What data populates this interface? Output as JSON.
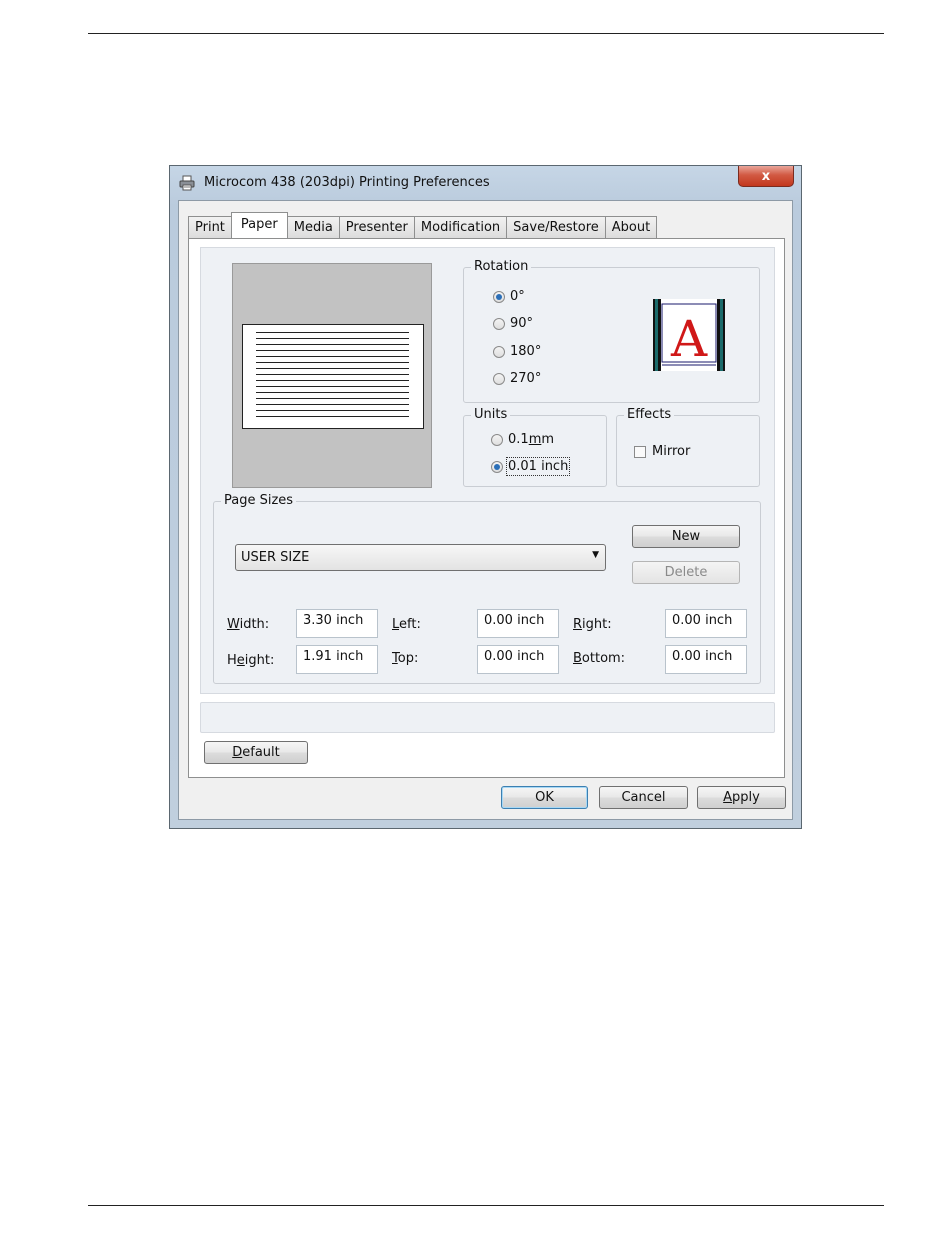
{
  "window": {
    "title": "Microcom 438 (203dpi) Printing Preferences",
    "close_glyph": "x",
    "icon": "printer-icon"
  },
  "tabs": [
    {
      "label": "Print"
    },
    {
      "label": "Paper"
    },
    {
      "label": "Media"
    },
    {
      "label": "Presenter"
    },
    {
      "label": "Modification"
    },
    {
      "label": "Save/Restore"
    },
    {
      "label": "About"
    }
  ],
  "active_tab": "Paper",
  "rotation": {
    "label": "Rotation",
    "options": [
      "0°",
      "90°",
      "180°",
      "270°"
    ],
    "selected": "0°",
    "preview_letter": "A"
  },
  "units": {
    "label": "Units",
    "options": [
      {
        "pre": "0.1 ",
        "accel": "m",
        "post": "m"
      },
      {
        "pre": "0.01 inch",
        "accel": "",
        "post": ""
      }
    ],
    "selected": "0.01 inch"
  },
  "effects": {
    "label": "Effects",
    "mirror_label": "Mirror",
    "mirror_checked": false
  },
  "page_sizes": {
    "label": "Page Sizes",
    "selected": "USER SIZE",
    "new_button": "New",
    "delete_button": "Delete",
    "fields": {
      "width": {
        "accel": "W",
        "rest": "idth:",
        "value": "3.30 inch"
      },
      "height": {
        "pre": "H",
        "accel": "e",
        "rest": "ight:",
        "value": "1.91 inch"
      },
      "left": {
        "accel": "L",
        "rest": "eft:",
        "value": "0.00 inch"
      },
      "top": {
        "accel": "T",
        "rest": "op:",
        "value": "0.00 inch"
      },
      "right": {
        "accel": "R",
        "rest": "ight:",
        "value": "0.00 inch"
      },
      "bottom": {
        "accel": "B",
        "rest": "ottom:",
        "value": "0.00 inch"
      }
    }
  },
  "buttons": {
    "default": {
      "accel": "D",
      "rest": "efault"
    },
    "ok": "OK",
    "cancel": "Cancel",
    "apply": {
      "accel": "A",
      "rest": "pply"
    }
  },
  "colors": {
    "accent": "#2b6fb8",
    "letter_red": "#d01818",
    "close_red": "#c2371d"
  }
}
